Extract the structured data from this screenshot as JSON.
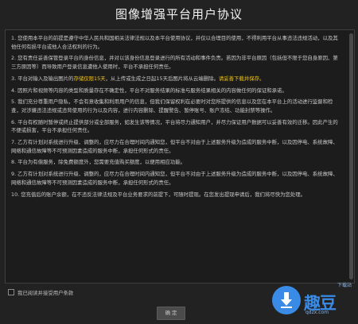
{
  "title": "图像增强平台用户协议",
  "paragraphs": [
    {
      "pre": "1. 您使用本平台的前提是遵守中华人民共和国相关法律法规以及本平台使用协议，并仅以合理目的使用，不得利用平台从事违法违规活动，以及其他任何有损平台或他人合法权利的行为。",
      "hl": "",
      "post": ""
    },
    {
      "pre": "2. 您有责任妥善保管登录平台的身份信息，并对以该身份信息登录进行的所有活动和事件负责。若因为非平台原因（包括但不限于您自身原因、第三方原因等）而导致用户登录信息遭他人使用时，平台不承担任何责任。",
      "hl": "",
      "post": ""
    },
    {
      "pre": "3. 平台对输入及输出图片的",
      "hl": "存储仅限15天",
      "post": "，从上传或生成之日起15天后图片将从云端删除。",
      "hl2": "请妥善下载并保存。",
      "post2": ""
    },
    {
      "pre": "4. 因照片和视频等内容的类型和质量存在不确定性，平台不对服务结果的标准与服务结果相关的内容做任何的保证和承诺。",
      "hl": "",
      "post": ""
    },
    {
      "pre": "5. 我们充分尊重用户隐私，不会有意收集和利用用户的信息，但我们保留权利在必要时对您所提供的信息以及您在本平台上的活动进行监督和检查，对涉嫌违法违规或违背使用的行为以及内容，进行内容删除、提醒警告、暂停账号、账户冻结、功能封禁等操作。",
      "hl": "",
      "post": ""
    },
    {
      "pre": "6. 平台有权随时暂停或终止提供部分或全部服务，如发生该等情况，平台将尽力通知用户，并尽力保证用户数据可以妥善有效的迁移。因此产生的不便或损害，平台不承担任何责任。",
      "hl": "",
      "post": ""
    },
    {
      "pre": "7. 乙方有计划对系统进行升级、调整的，应尽力在合理时间内通知您，但平台不对由于上述服务升级为造成的服务中断，以及因停电、系统故障、网络和通信故障等不可预测因素造成的服务中断，承担任何形式的责任。",
      "hl": "",
      "post": ""
    },
    {
      "pre": "8. 平台为有偿服务，除免费额度外，您需要充值购买额度，以便用相应功能。",
      "hl": "",
      "post": ""
    },
    {
      "pre": "9. 乙方有计划对系统进行升级、调整的，应尽力在合理时间内通知您，但平台不对由于上述服务升级为造成的服务中断，以及因停电、系统故障、网络和通信故障等不可预测因素造成的服务中断，承担任何形式的责任。",
      "hl": "",
      "post": ""
    },
    {
      "pre": "10. 您充值后的账户余额，在不违反法律法规及平台业务要求的前提下，可随时提现。在您发出提现申请后，我们将尽快为您处理。",
      "hl": "",
      "post": ""
    }
  ],
  "agree_label": "我已阅读并接受用户条款",
  "confirm_label": "确 定",
  "watermark": {
    "brand": "趣豆",
    "site": "qdzx.com",
    "corner": "下载站"
  },
  "colors": {
    "background": "#222222",
    "highlight": "#f0c419",
    "watermark": "#3a8be6"
  }
}
